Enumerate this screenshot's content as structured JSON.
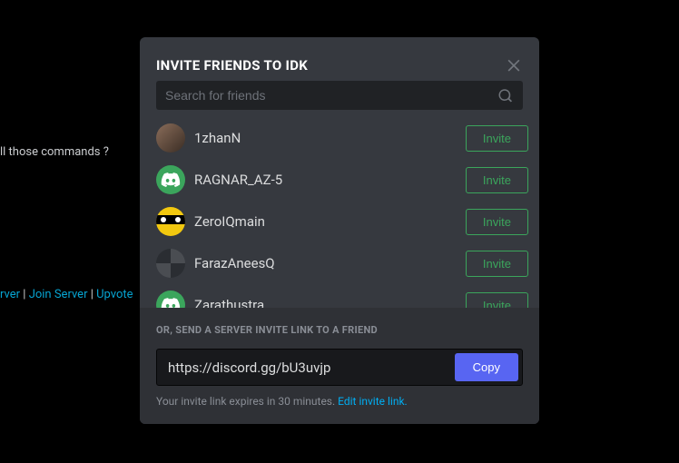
{
  "bg_text_top": "ll those commands ?",
  "bg_text_bottom_a": "rver",
  "bg_text_bottom_b": "Join Server",
  "bg_text_bottom_c": "Upvote",
  "modal": {
    "title": "INVITE FRIENDS TO IDK",
    "search_placeholder": "Search for friends",
    "friends": [
      {
        "name": "1zhanN",
        "avatar": "photo1",
        "invite": "Invite"
      },
      {
        "name": "RAGNAR_AZ-5",
        "avatar": "discord-green",
        "invite": "Invite"
      },
      {
        "name": "ZeroIQmain",
        "avatar": "yellow-eyes",
        "invite": "Invite"
      },
      {
        "name": "FarazAneesQ",
        "avatar": "checker",
        "invite": "Invite"
      },
      {
        "name": "Zarathustra",
        "avatar": "discord-green",
        "invite": "Invite"
      }
    ],
    "footer_label": "OR, SEND A SERVER INVITE LINK TO A FRIEND",
    "invite_link": "https://discord.gg/bU3uvjp",
    "copy": "Copy",
    "expire_text": "Your invite link expires in 30 minutes. ",
    "edit_link": "Edit invite link."
  }
}
